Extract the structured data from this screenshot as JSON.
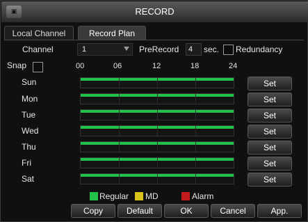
{
  "window": {
    "title": "RECORD",
    "app_icon": "dvr-icon"
  },
  "tabs": [
    {
      "label": "Local Channel"
    },
    {
      "label": "Record Plan"
    }
  ],
  "settings": {
    "channel_label": "Channel",
    "channel_value": "1",
    "prerecord_label": "PreRecord",
    "prerecord_value": "4",
    "sec_label": "sec.",
    "redundancy_label": "Redundancy",
    "redundancy_checked": false,
    "snap_label": "Snap",
    "snap_checked": false
  },
  "timeline": {
    "ticks": [
      "00",
      "06",
      "12",
      "18",
      "24"
    ],
    "regular_coverage": 1.0
  },
  "days": [
    {
      "label": "Sun",
      "button": "Set"
    },
    {
      "label": "Mon",
      "button": "Set"
    },
    {
      "label": "Tue",
      "button": "Set"
    },
    {
      "label": "Wed",
      "button": "Set"
    },
    {
      "label": "Thu",
      "button": "Set"
    },
    {
      "label": "Fri",
      "button": "Set"
    },
    {
      "label": "Sat",
      "button": "Set"
    }
  ],
  "legend": [
    {
      "label": "Regular",
      "color": "#22c24a"
    },
    {
      "label": "MD",
      "color": "#d8c21a"
    },
    {
      "label": "Alarm",
      "color": "#c41c1c"
    }
  ],
  "footer": {
    "copy": "Copy",
    "default": "Default",
    "ok": "OK",
    "cancel": "Cancel",
    "apply": "App."
  }
}
